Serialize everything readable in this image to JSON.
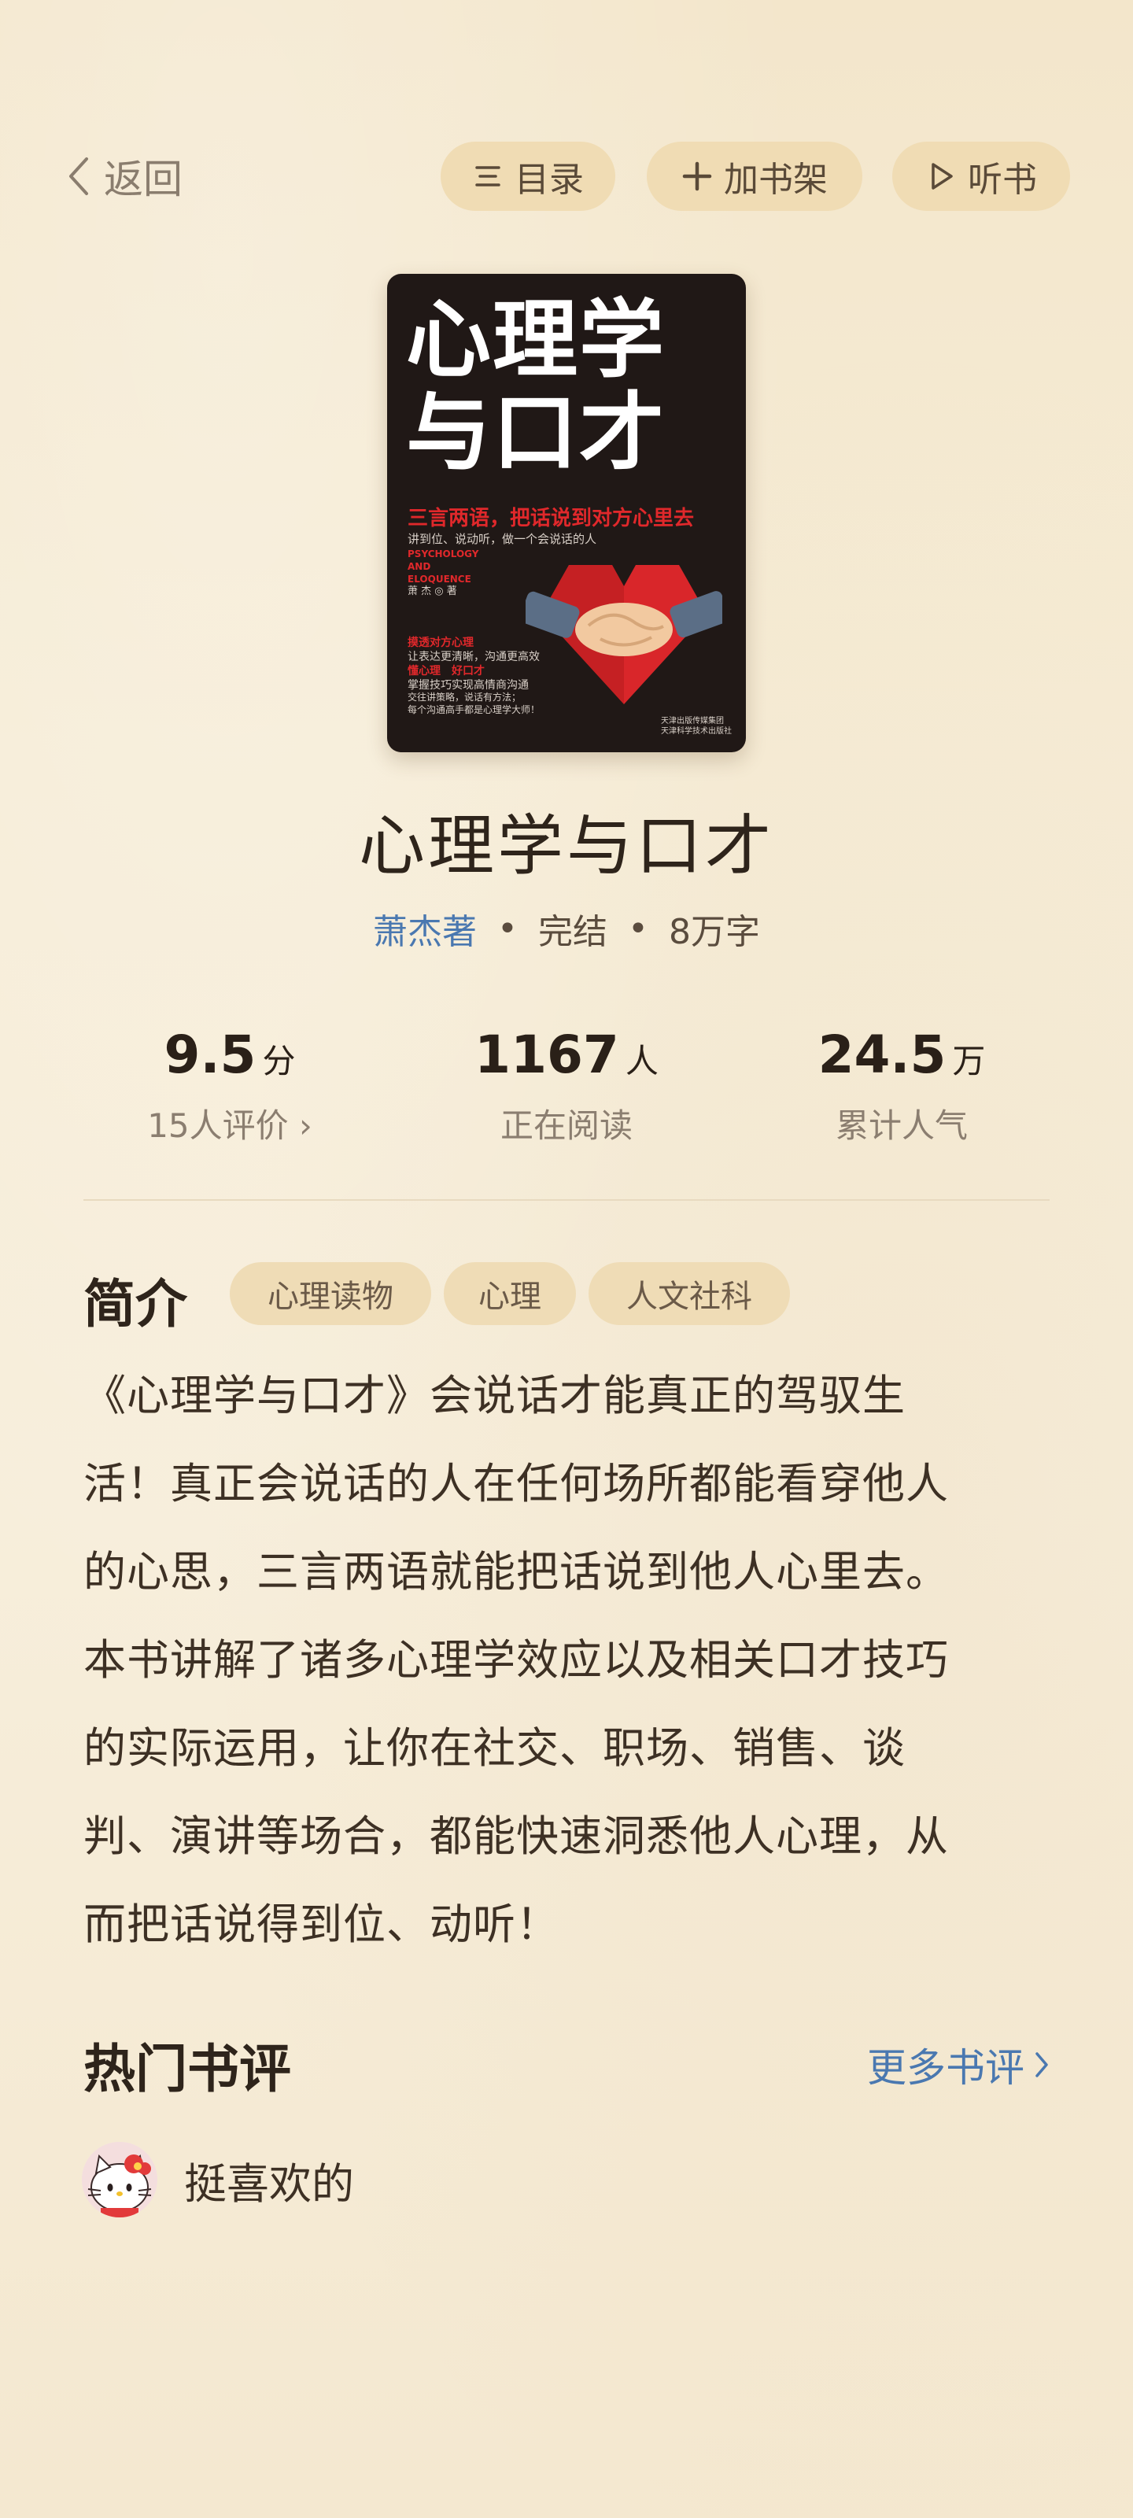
{
  "topbar": {
    "back_label": "返回",
    "toc_label": "目录",
    "shelf_label": "加书架",
    "listen_label": "听书"
  },
  "cover": {
    "title_line1": "心理学",
    "title_line2": "与口才",
    "tagline": "三言两语，把话说到对方心里去",
    "subtagline": "讲到位、说动听，做一个会说话的人",
    "english": [
      "PSYCHOLOGY",
      "AND",
      "ELOQUENCE"
    ],
    "author": "萧 杰 ◎ 著",
    "blurb_lines": [
      "摸透对方心理",
      "让表达更清晰，沟通更高效",
      "懂心理　好口才",
      "掌握技巧实现高情商沟通"
    ],
    "blurb_small_lines": [
      "交往讲策略，说话有方法；",
      "每个沟通高手都是心理学大师！"
    ],
    "publisher_lines": [
      "天津出版传媒集团",
      "天津科学技术出版社"
    ]
  },
  "book": {
    "title": "心理学与口才",
    "author": "萧杰著",
    "status": "完结",
    "word_count": "8万字",
    "separator": "•"
  },
  "stats": {
    "score": {
      "value": "9.5",
      "unit": "分",
      "caption": "15人评价 ›"
    },
    "readers": {
      "value": "1167",
      "unit": "人",
      "caption": "正在阅读"
    },
    "popularity": {
      "value": "24.5",
      "unit": "万",
      "caption": "累计人气"
    }
  },
  "intro": {
    "heading": "简介",
    "tags": [
      "心理读物",
      "心理",
      "人文社科"
    ],
    "lines": [
      "《心理学与口才》会说话才能真正的驾驭生",
      "活！真正会说话的人在任何场所都能看穿他人",
      "的心思，三言两语就能把话说到他人心里去。",
      "本书讲解了诸多心理学效应以及相关口才技巧",
      "的实际运用，让你在社交、职场、销售、谈",
      "判、演讲等场合，都能快速洞悉他人心理，从",
      "而把话说得到位、动听！"
    ]
  },
  "reviews": {
    "heading": "热门书评",
    "more_label": "更多书评",
    "items": [
      {
        "text": "挺喜欢的",
        "avatar_icon": "hello-kitty-avatar"
      }
    ]
  },
  "colors": {
    "background": "#f6ecd6",
    "pill": "#f0dcb4",
    "link_blue": "#4a78b0",
    "cover_red": "#e0282b"
  }
}
